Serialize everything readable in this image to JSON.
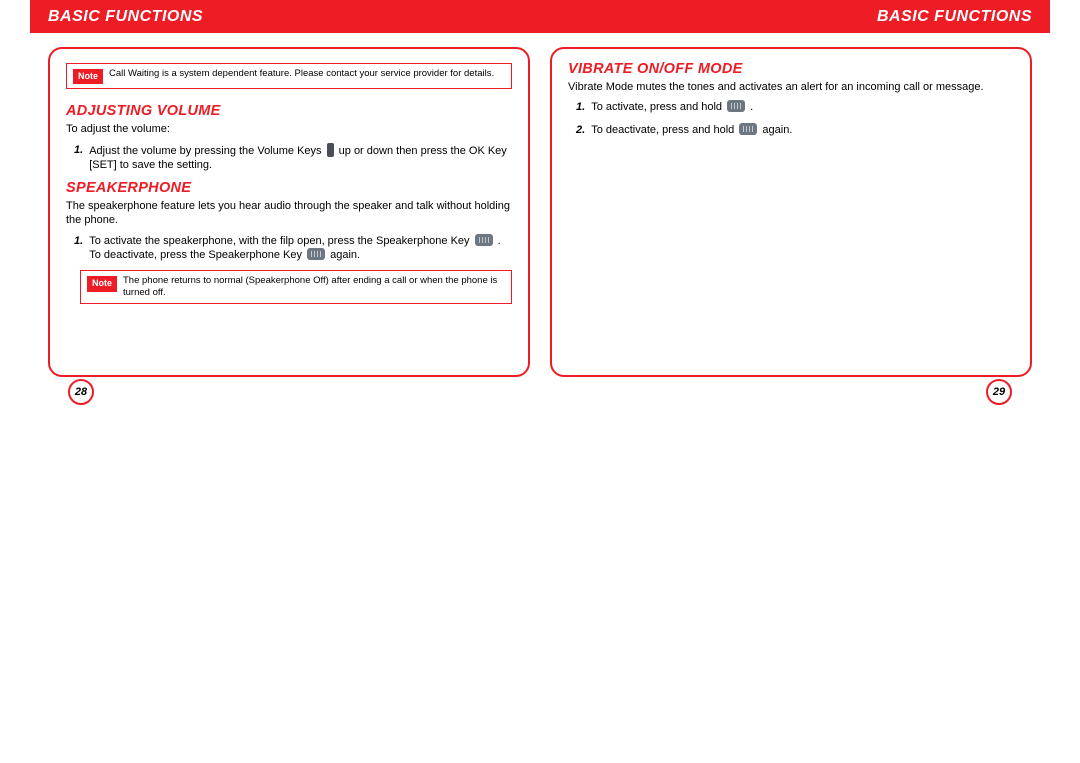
{
  "left": {
    "header": "BASIC FUNCTIONS",
    "note1_label": "Note",
    "note1_text": "Call Waiting is a system dependent feature. Please contact your service provider for details.",
    "section1_title": "ADJUSTING VOLUME",
    "section1_intro": "To adjust the volume:",
    "section1_step1_num": "1.",
    "section1_step1_a": "Adjust the volume by pressing the Volume Keys ",
    "section1_step1_b": " up or down then press the OK Key [SET] to save the setting.",
    "section2_title": "SPEAKERPHONE",
    "section2_intro": "The speakerphone feature lets you hear audio through the speaker and talk without holding the phone.",
    "section2_step1_num": "1.",
    "section2_step1_a": "To activate the speakerphone, with the filp open, press the Speakerphone Key ",
    "section2_step1_b": " . To deactivate, press the Speakerphone Key ",
    "section2_step1_c": " again.",
    "note2_label": "Note",
    "note2_text": "The phone returns to normal (Speakerphone Off) after ending a call or when the phone is turned off.",
    "page_number": "28"
  },
  "right": {
    "header": "BASIC FUNCTIONS",
    "section1_title": "VIBRATE ON/OFF MODE",
    "section1_intro": "Vibrate Mode mutes the tones and activates an alert for an incoming call or message.",
    "step1_num": "1.",
    "step1_a": "To activate, press and hold ",
    "step1_b": " .",
    "step2_num": "2.",
    "step2_a": "To deactivate, press and hold ",
    "step2_b": " again.",
    "page_number": "29"
  }
}
